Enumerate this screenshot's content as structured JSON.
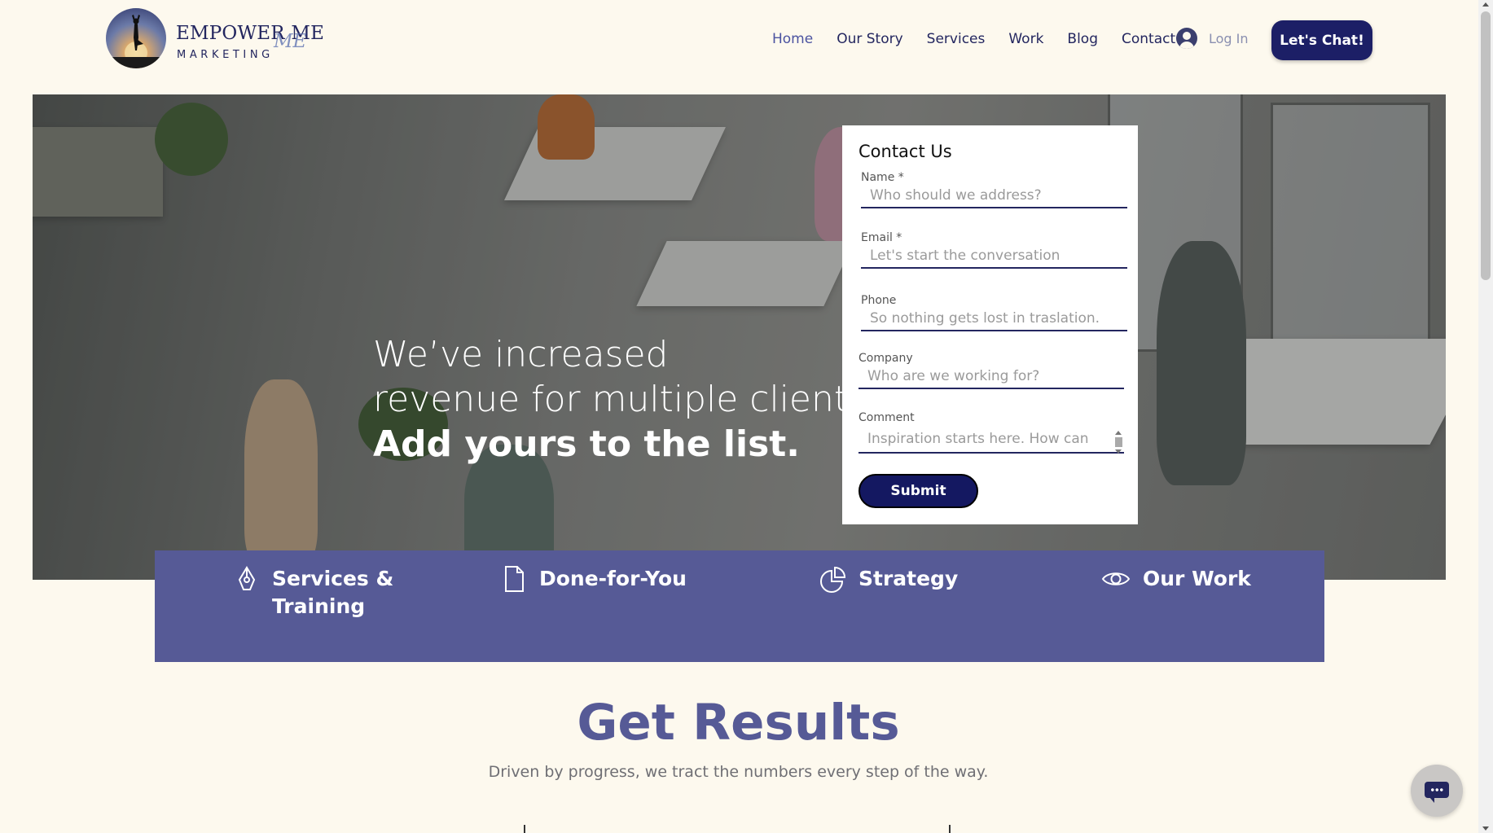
{
  "brand": {
    "line1": "EMPOWER ME",
    "line2": "MARKETING",
    "accent": "ME"
  },
  "nav": {
    "items": [
      {
        "label": "Home",
        "active": true
      },
      {
        "label": "Our Story"
      },
      {
        "label": "Services"
      },
      {
        "label": "Work"
      },
      {
        "label": "Blog"
      },
      {
        "label": "Contact"
      }
    ],
    "login_label": "Log In",
    "cta_label": "Let's Chat!"
  },
  "hero": {
    "line1": "We’ve increased",
    "line2": "revenue for multiple clients.",
    "line3": "Add yours to the list."
  },
  "contact_form": {
    "title": "Contact Us",
    "fields": {
      "name": {
        "label": "Name *",
        "placeholder": "Who should we address?"
      },
      "email": {
        "label": "Email *",
        "placeholder": "Let's start the conversation"
      },
      "phone": {
        "label": "Phone",
        "placeholder": "So nothing gets lost in traslation."
      },
      "company": {
        "label": "Company",
        "placeholder": "Who are we working for?"
      },
      "comment": {
        "label": "Comment",
        "placeholder": "Inspiration starts here. How can"
      }
    },
    "submit_label": "Submit"
  },
  "features": [
    {
      "line1": "Services &",
      "line2": "Training",
      "icon": "pen-nib-icon"
    },
    {
      "line1": "Done-for-You",
      "icon": "document-icon"
    },
    {
      "line1": "Strategy",
      "icon": "pie-chart-icon"
    },
    {
      "line1": "Our Work",
      "icon": "eye-icon"
    }
  ],
  "results": {
    "title": "Get Results",
    "subtitle": "Driven by progress, we tract the numbers every step of the way."
  },
  "colors": {
    "background": "#fdf9ee",
    "navy": "#1c1f66",
    "band": "#565a96",
    "text": "#23265f"
  }
}
